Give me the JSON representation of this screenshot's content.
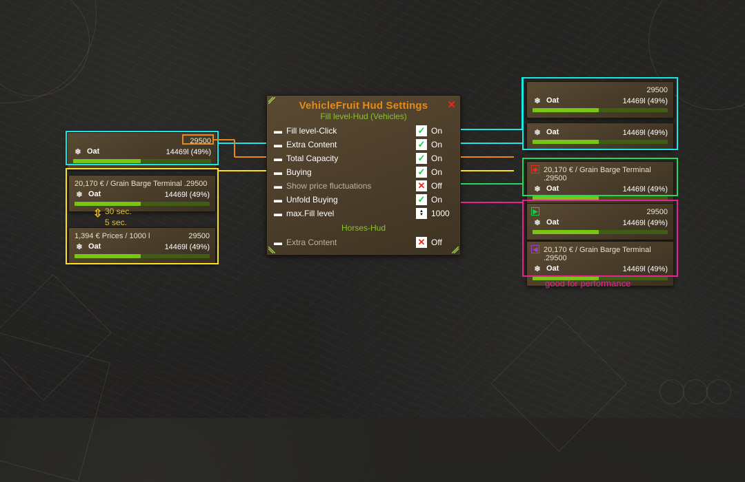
{
  "settings": {
    "title": "VehicleFruit Hud Settings",
    "section1": "Fill level-Hud (Vehicles)",
    "section2": "Horses-Hud",
    "close_tooltip": "Close",
    "rows": {
      "fill_click": {
        "label": "Fill level-Click",
        "state": "On",
        "on": true
      },
      "extra": {
        "label": "Extra Content",
        "state": "On",
        "on": true
      },
      "total": {
        "label": "Total Capacity",
        "state": "On",
        "on": true
      },
      "buying": {
        "label": "Buying",
        "state": "On",
        "on": true
      },
      "fluct": {
        "label": "Show price fluctuations",
        "state": "Off",
        "on": false
      },
      "unfold": {
        "label": "Unfold Buying",
        "state": "On",
        "on": true
      },
      "maxfill": {
        "label": "max.Fill level",
        "value": "1000"
      },
      "h_extra": {
        "label": "Extra Content",
        "state": "Off",
        "on": false
      }
    }
  },
  "hud": {
    "crop": "Oat",
    "capacity": "29500",
    "fill": "14469l (49%)",
    "buy_line": "20,170 € / Grain Barge Terminal .29500",
    "price_line": "1,394 € Prices / 1000 l",
    "timing": {
      "long": "30 sec.",
      "short": "5 sec."
    }
  },
  "caption_perf": "good for performance",
  "colors": {
    "cyan": "#1be6e6",
    "orange": "#e58a20",
    "yellow": "#ffe020",
    "green": "#23d85a",
    "magenta": "#e62390"
  }
}
